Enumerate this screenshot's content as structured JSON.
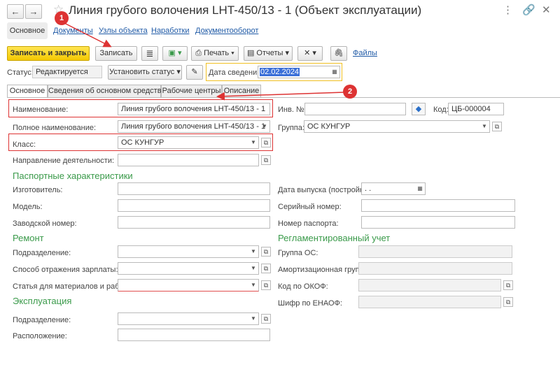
{
  "window": {
    "title": "Линия грубого волочения LHT-450/13 - 1 (Объект эксплуатации)",
    "back_glyph": "←",
    "forward_glyph": "→",
    "star_glyph": "☆",
    "more_glyph": "⋮",
    "link_glyph": "🔗",
    "close_glyph": "✕"
  },
  "nav": {
    "active": "Основное",
    "links": [
      "Документы",
      "Узлы объекта",
      "Наработки",
      "Документооборот"
    ]
  },
  "toolbar": {
    "save_close": "Записать и закрыть",
    "save": "Записать",
    "print": "Печать",
    "reports": "Отчеты",
    "files": "Файлы"
  },
  "status": {
    "label": "Статус:",
    "value": "Редактируется",
    "set_status": "Установить статус",
    "date_label": "Дата сведений:",
    "date_value": "02.02.2024"
  },
  "tabs": [
    "Основное",
    "Сведения об основном средстве",
    "Рабочие центры",
    "Описание"
  ],
  "form": {
    "name_label": "Наименование:",
    "name_value": "Линия грубого волочения LHT-450/13 - 1",
    "fullname_label": "Полное наименование:",
    "fullname_value": "Линия грубого волочения LHT-450/13 - 1",
    "class_label": "Класс:",
    "class_value": "ОС КУНГУР",
    "direction_label": "Направление деятельности:",
    "inv_label": "Инв. №:",
    "code_label": "Код:",
    "code_value": "ЦБ-000004",
    "group_label": "Группа:",
    "group_value": "ОС КУНГУР"
  },
  "passport": {
    "title": "Паспортные характеристики",
    "manufacturer": "Изготовитель:",
    "model": "Модель:",
    "serial_factory": "Заводской номер:",
    "release_date": "Дата выпуска (постройки):",
    "release_date_value": " .  .",
    "serial": "Серийный номер:",
    "passport_no": "Номер паспорта:"
  },
  "repair": {
    "title": "Ремонт",
    "department": "Подразделение:",
    "salary": "Способ отражения зарплаты:",
    "materials": "Статья для материалов и работ:"
  },
  "regulated": {
    "title": "Регламентированный учет",
    "os_group": "Группа ОС:",
    "amort_group": "Амортизационная группа:",
    "okof": "Код по ОКОФ:",
    "enaof": "Шифр по ЕНАОФ:"
  },
  "exploitation": {
    "title": "Эксплуатация",
    "department": "Подразделение:",
    "location": "Расположение:"
  },
  "annotations": {
    "badge1": "1",
    "badge2": "2"
  },
  "colors": {
    "accent_yellow": "#f4c800",
    "section_green": "#3a9a4a",
    "annotation_red": "#d33333",
    "link_blue": "#1f5aa6"
  }
}
